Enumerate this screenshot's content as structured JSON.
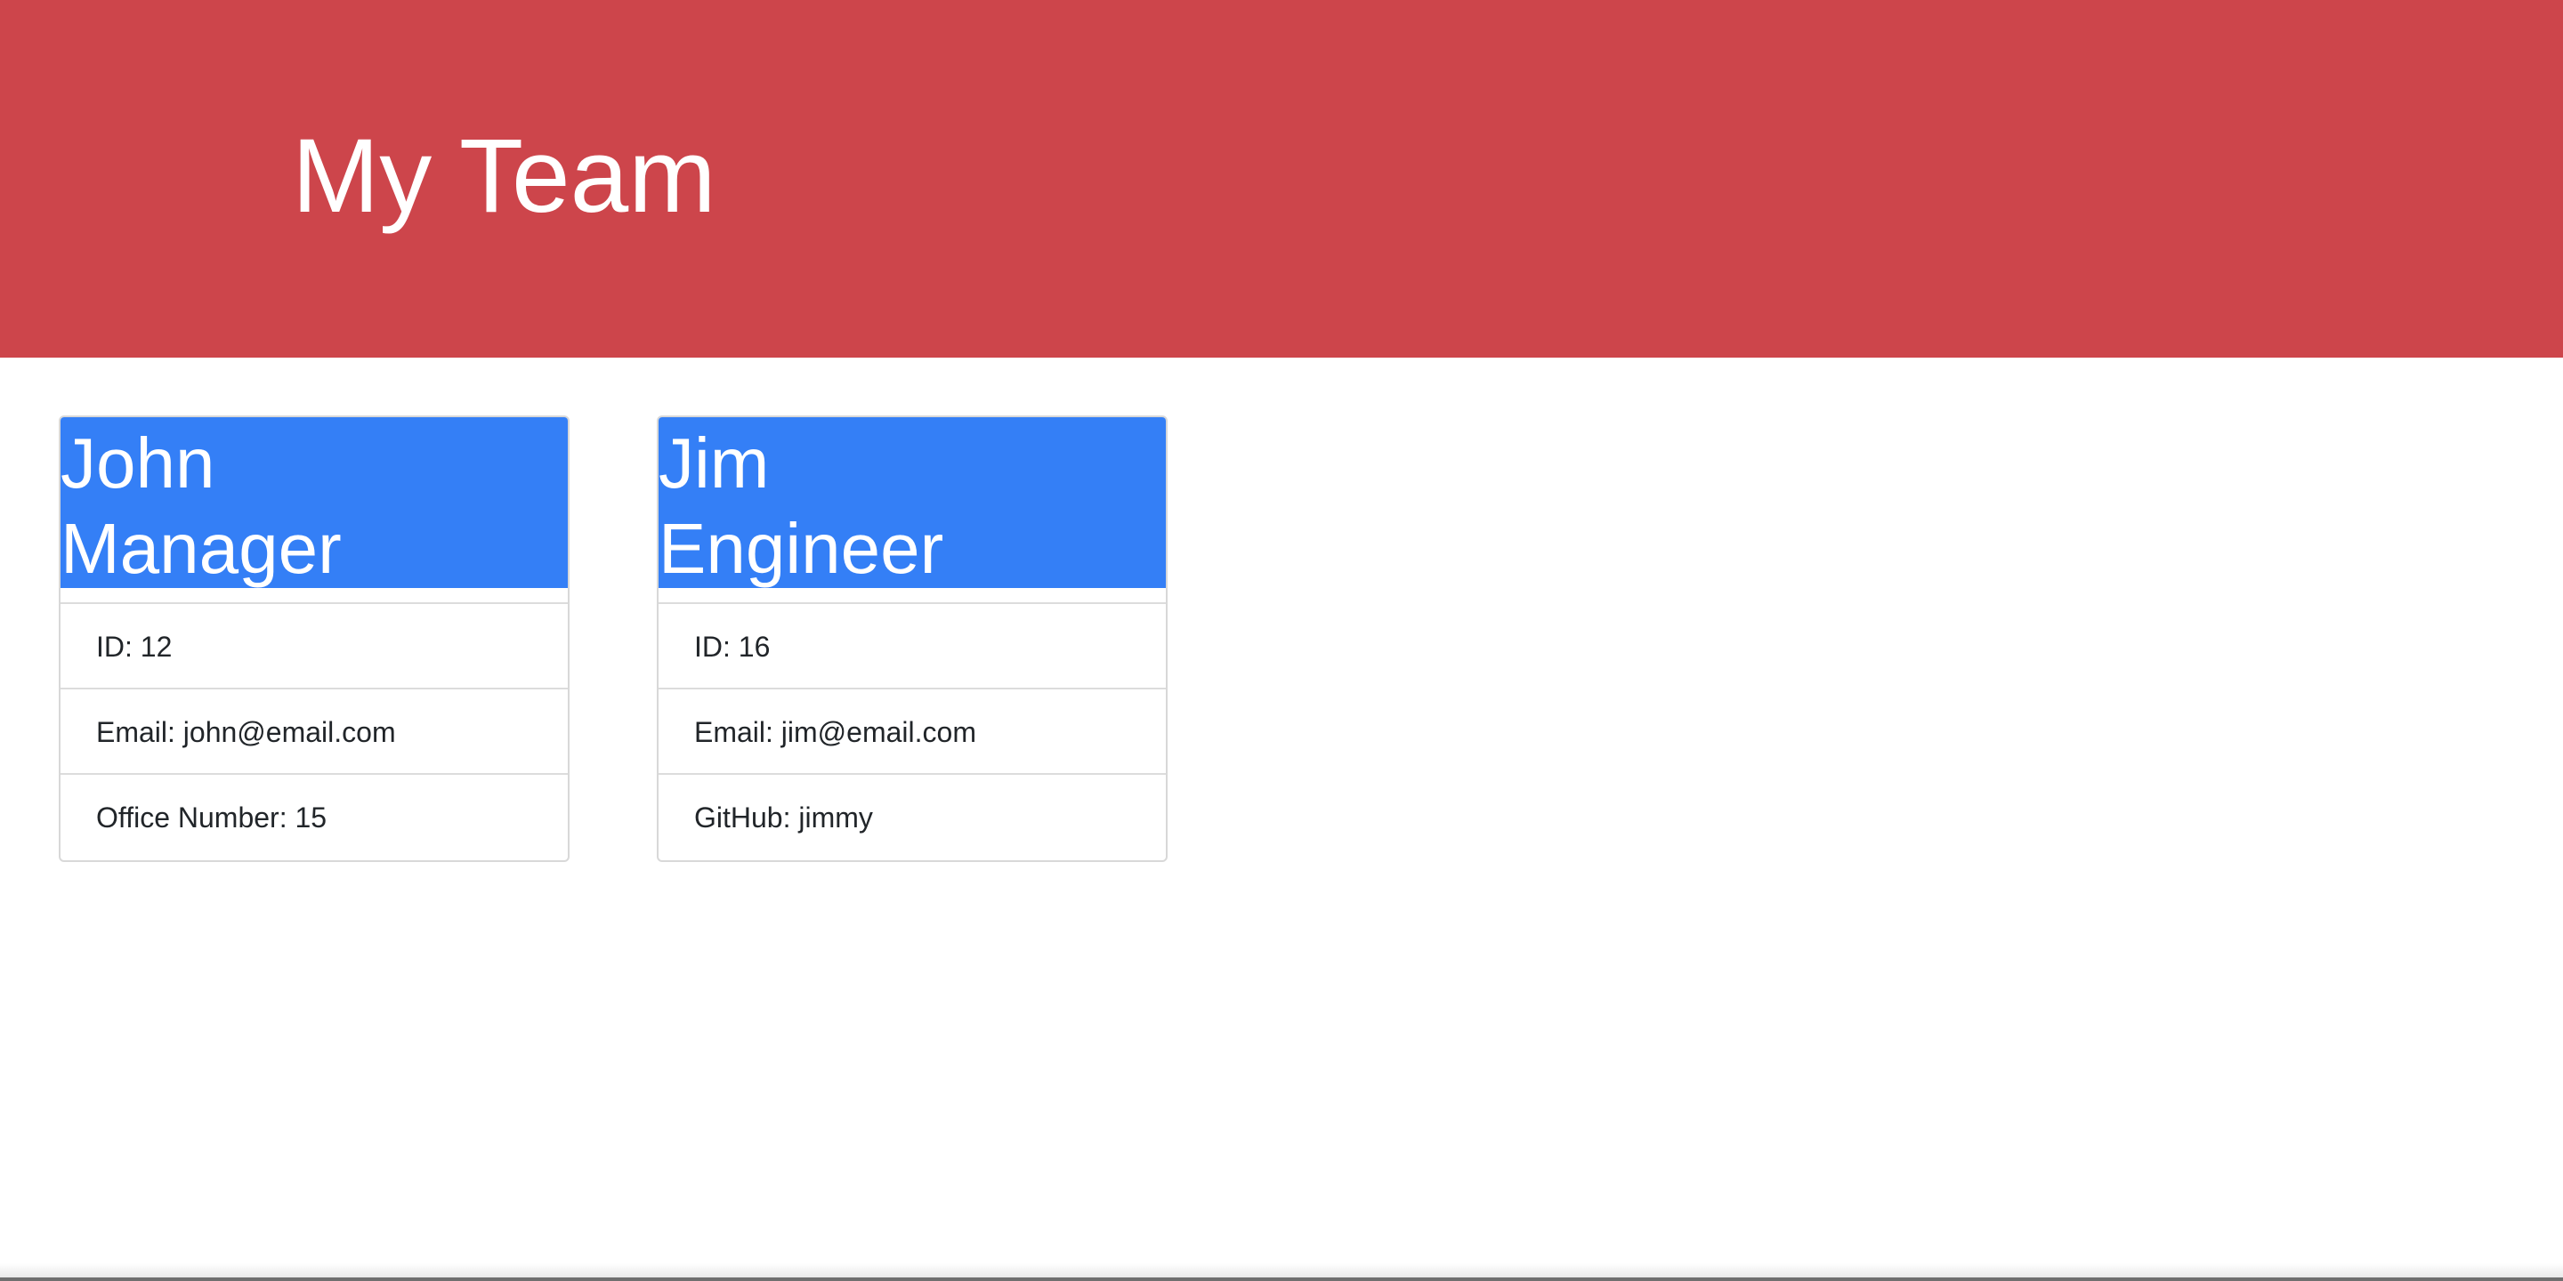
{
  "header": {
    "title": "My Team"
  },
  "colors": {
    "header_bg": "#cd454b",
    "card_header_bg": "#347ff6"
  },
  "cards": [
    {
      "name": "John",
      "role": "Manager",
      "id_text": "ID: 12",
      "email_text": "Email: john@email.com",
      "extra_text": "Office Number: 15"
    },
    {
      "name": "Jim",
      "role": "Engineer",
      "id_text": "ID: 16",
      "email_text": "Email: jim@email.com",
      "extra_text": "GitHub: jimmy"
    }
  ]
}
